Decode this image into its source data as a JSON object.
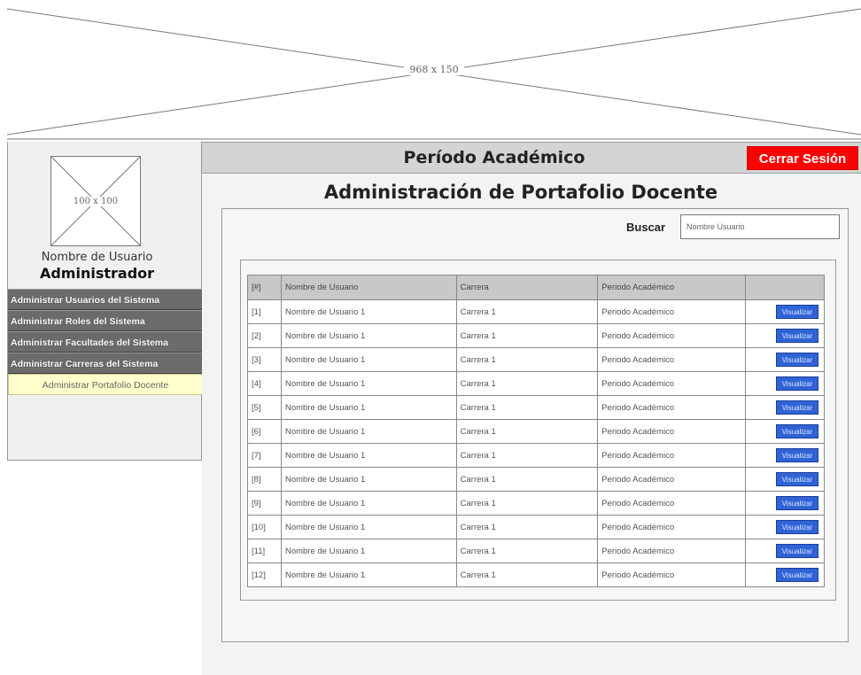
{
  "banner": {
    "placeholder_text": "968 x 150"
  },
  "sidebar": {
    "avatar_placeholder": "100 x 100",
    "user_name": "Nombre de Usuario",
    "user_role": "Administrador",
    "menu": [
      {
        "label": "Administrar Usuarios del Sistema",
        "active": false
      },
      {
        "label": "Administrar Roles del Sistema",
        "active": false
      },
      {
        "label": "Administrar Facultades del Sistema",
        "active": false
      },
      {
        "label": "Administrar Carreras del Sistema",
        "active": false
      },
      {
        "label": "Administrar Portafolio Docente",
        "active": true
      }
    ]
  },
  "header": {
    "title": "Período Académico",
    "logout_label": "Cerrar Sesión"
  },
  "main": {
    "title": "Administración de Portafolio Docente",
    "search": {
      "label": "Buscar",
      "value": "Nombre Usuario"
    },
    "table": {
      "headers": [
        "[#]",
        "Nombre de Usuario",
        "Carrera",
        "Periodo Académico",
        ""
      ],
      "rows": [
        [
          "[1]",
          "Nombre de Usuario 1",
          "Carrera 1",
          "Periodo Académico",
          "Visualizar"
        ],
        [
          "[2]",
          "Nombre de Usuario 1",
          "Carrera 1",
          "Periodo Académico",
          "Visualizar"
        ],
        [
          "[3]",
          "Nombre de Usuario 1",
          "Carrera 1",
          "Periodo Académico",
          "Visualizar"
        ],
        [
          "[4]",
          "Nombre de Usuario 1",
          "Carrera 1",
          "Periodo Académico",
          "Visualizar"
        ],
        [
          "[5]",
          "Nombre de Usuario 1",
          "Carrera 1",
          "Periodo Académico",
          "Visualizar"
        ],
        [
          "[6]",
          "Nombre de Usuario 1",
          "Carrera 1",
          "Periodo Académico",
          "Visualizar"
        ],
        [
          "[7]",
          "Nombre de Usuario 1",
          "Carrera 1",
          "Periodo Académico",
          "Visualizar"
        ],
        [
          "[8]",
          "Nombre de Usuario 1",
          "Carrera 1",
          "Periodo Académico",
          "Visualizar"
        ],
        [
          "[9]",
          "Nombre de Usuario 1",
          "Carrera 1",
          "Periodo Académico",
          "Visualizar"
        ],
        [
          "[10]",
          "Nombre de Usuario 1",
          "Carrera 1",
          "Periodo Académico",
          "Visualizar"
        ],
        [
          "[11]",
          "Nombre de Usuario 1",
          "Carrera 1",
          "Periodo Académico",
          "Visualizar"
        ],
        [
          "[12]",
          "Nombre de Usuario 1",
          "Carrera 1",
          "Periodo Académico",
          "Visualizar"
        ]
      ]
    }
  },
  "colors": {
    "logout_bg": "#ff0000",
    "menu_bg": "#6b6b6b",
    "menu_active_bg": "#ffffcc",
    "view_button_bg": "#2f63d6",
    "header_bg": "#d4d4d4"
  }
}
